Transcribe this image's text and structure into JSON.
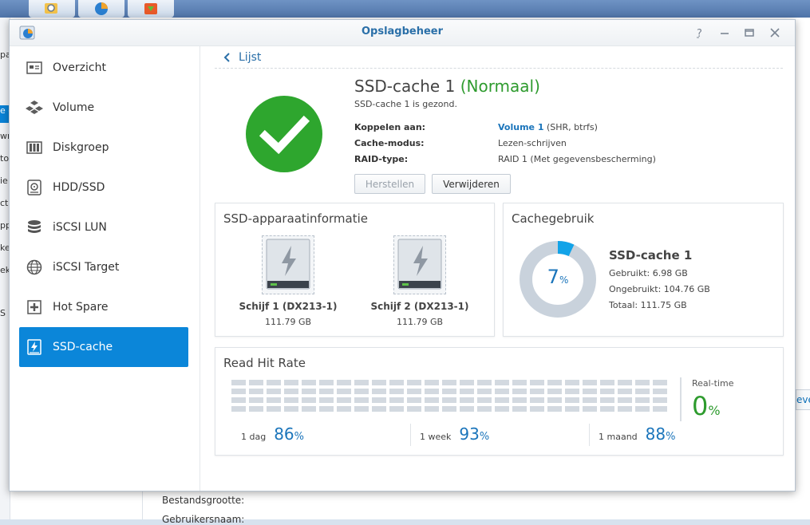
{
  "window": {
    "title": "Opslagbeheer"
  },
  "nav": {
    "items": [
      {
        "label": "Overzicht",
        "icon": "overview-icon"
      },
      {
        "label": "Volume",
        "icon": "volume-icon"
      },
      {
        "label": "Diskgroep",
        "icon": "disk-group-icon"
      },
      {
        "label": "HDD/SSD",
        "icon": "hdd-icon"
      },
      {
        "label": "iSCSI LUN",
        "icon": "iscsi-lun-icon"
      },
      {
        "label": "iSCSI Target",
        "icon": "iscsi-target-icon"
      },
      {
        "label": "Hot Spare",
        "icon": "hot-spare-icon"
      },
      {
        "label": "SSD-cache",
        "icon": "ssd-cache-icon",
        "active": true
      }
    ]
  },
  "header": {
    "back_label": "Lijst",
    "title": "SSD-cache 1",
    "status": "(Normaal)",
    "subtitle": "SSD-cache 1 is gezond.",
    "fields": [
      {
        "key": "Koppelen aan:",
        "link": "Volume 1",
        "value": " (SHR, btrfs)"
      },
      {
        "key": "Cache-modus:",
        "link": "",
        "value": "Lezen-schrijven"
      },
      {
        "key": "RAID-type:",
        "link": "",
        "value": "RAID 1 (Met gegevensbescherming)"
      }
    ],
    "buttons": {
      "repair": "Herstellen",
      "remove": "Verwijderen"
    }
  },
  "ssd_info": {
    "title": "SSD-apparaatinformatie",
    "disks": [
      {
        "name": "Schijf 1 (DX213-1)",
        "size": "111.79 GB"
      },
      {
        "name": "Schijf 2 (DX213-1)",
        "size": "111.79 GB"
      }
    ]
  },
  "cache_usage": {
    "title": "Cachegebruik",
    "percent": "7",
    "percent_unit": "%",
    "used_fraction": 0.07,
    "name": "SSD-cache 1",
    "used": "Gebruikt: 6.98 GB",
    "unused": "Ongebruikt: 104.76 GB",
    "total": "Totaal: 111.75 GB"
  },
  "read_hit_rate": {
    "title": "Read Hit Rate",
    "realtime_label": "Real-time",
    "realtime_value": "0",
    "unit": "%",
    "stats": [
      {
        "label": "1 dag",
        "value": "86"
      },
      {
        "label": "1 week",
        "value": "93"
      },
      {
        "label": "1 maand",
        "value": "88"
      }
    ]
  },
  "background": {
    "label_size": "Bestandsgrootte:",
    "label_user": "Gebruikersnaam:",
    "right_fragment": "eve",
    "left_fragments": [
      "pa",
      "e c",
      "wr",
      "to",
      "ie",
      "ct",
      "pp",
      "ke",
      "ek",
      "S"
    ]
  },
  "colors": {
    "accent": "#0b86d9",
    "success": "#2ea62e",
    "link": "#1b75bb",
    "donut_track": "#c9d2dc",
    "donut_used": "#12a3e8"
  }
}
